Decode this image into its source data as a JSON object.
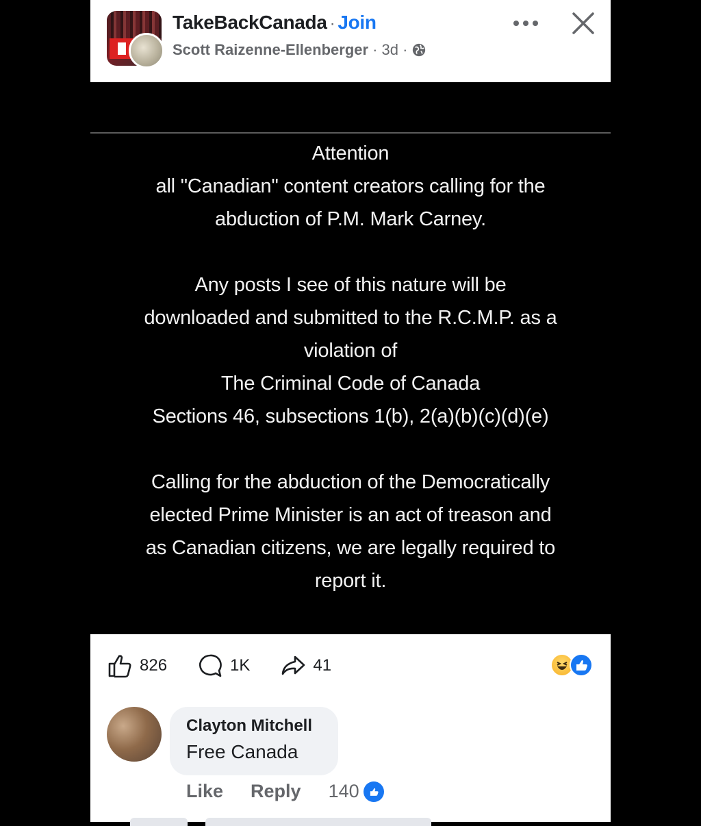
{
  "header": {
    "group_name": "TakeBackCanada",
    "separator": "·",
    "join_label": "Join",
    "author": "Scott Raizenne-Ellenberger",
    "meta": "· 3d ·",
    "privacy_icon": "globe-icon",
    "more_icon": "more-horizontal-icon",
    "close_icon": "close-icon"
  },
  "post": {
    "lines": [
      "Attention",
      "all \"Canadian\" content creators calling for the",
      "abduction of P.M. Mark Carney.",
      "",
      "Any posts I see of this nature will be",
      "downloaded and submitted to the R.C.M.P. as a",
      "violation of",
      "The Criminal Code of Canada",
      "Sections 46, subsections 1(b), 2(a)(b)(c)(d)(e)",
      "",
      "Calling for the abduction of the Democratically",
      "elected Prime Minister is an act of treason and",
      "as Canadian citizens, we are legally required to",
      "report it."
    ]
  },
  "stats": {
    "likes": "826",
    "comments": "1K",
    "shares": "41",
    "reaction_icons": [
      "haha-icon",
      "like-icon"
    ]
  },
  "comment": {
    "author": "Clayton Mitchell",
    "text": "Free Canada",
    "like_label": "Like",
    "reply_label": "Reply",
    "reaction_count": "140"
  },
  "colors": {
    "accent": "#1877f2",
    "post_bg": "#000000",
    "post_text": "#f2f2f2",
    "secondary_text": "#65676b"
  }
}
